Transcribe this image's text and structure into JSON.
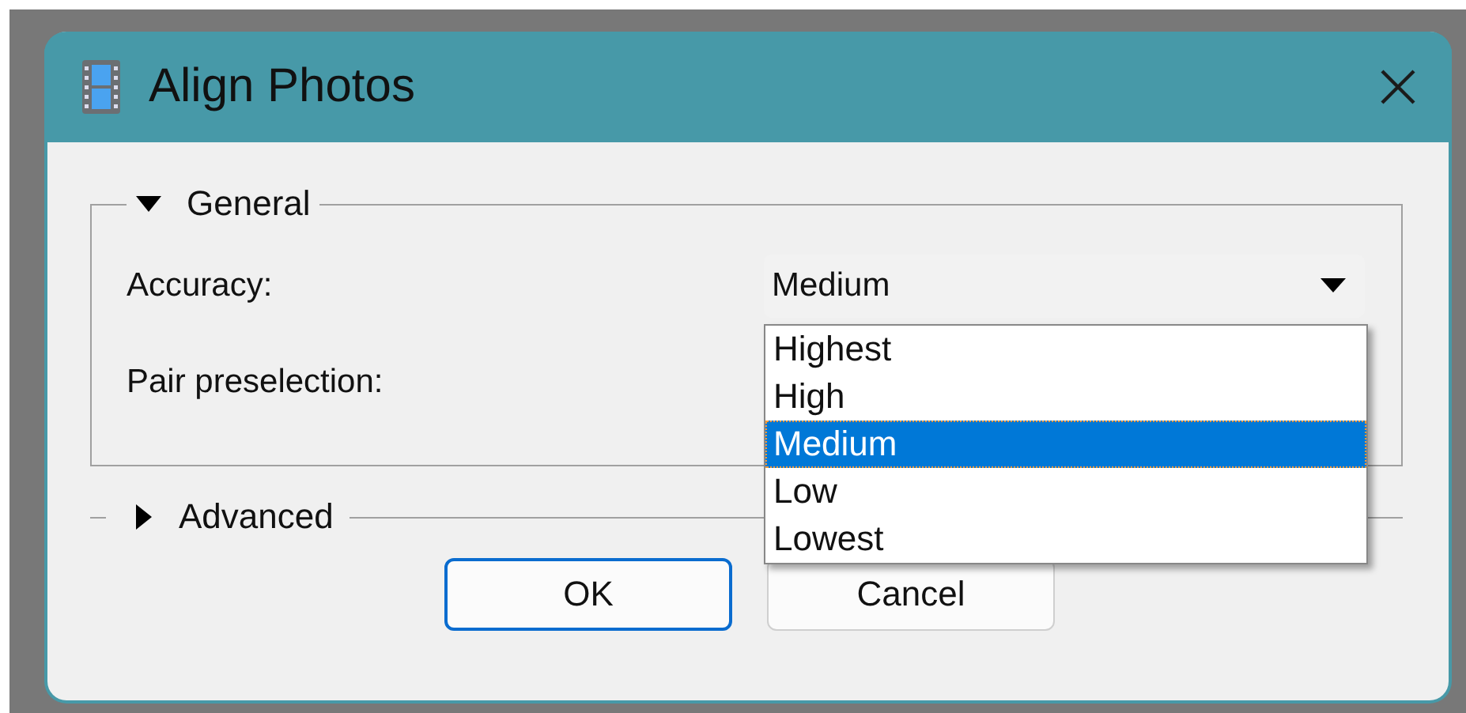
{
  "window": {
    "title": "Align Photos"
  },
  "sections": [
    {
      "title": "General",
      "expanded": true,
      "fields": [
        {
          "label": "Accuracy:",
          "value": "Medium",
          "dropdown_open": true,
          "options": [
            {
              "label": "Highest",
              "selected": false
            },
            {
              "label": "High",
              "selected": false
            },
            {
              "label": "Medium",
              "selected": true
            },
            {
              "label": "Low",
              "selected": false
            },
            {
              "label": "Lowest",
              "selected": false
            }
          ]
        },
        {
          "label": "Pair preselection:"
        }
      ]
    },
    {
      "title": "Advanced",
      "expanded": false
    }
  ],
  "buttons": [
    {
      "label": "OK",
      "default": true
    },
    {
      "label": "Cancel",
      "default": false
    }
  ]
}
